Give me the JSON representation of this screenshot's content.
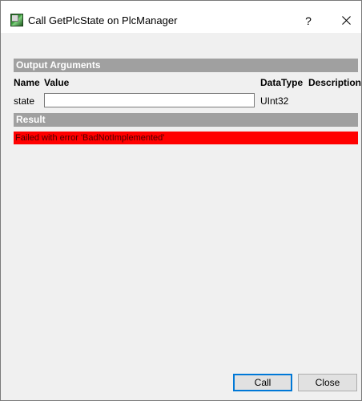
{
  "window": {
    "title": "Call GetPlcState on PlcManager",
    "help_label": "?"
  },
  "output_arguments": {
    "header": "Output Arguments",
    "columns": {
      "name": "Name",
      "value": "Value",
      "datatype": "DataType",
      "description": "Description"
    },
    "rows": [
      {
        "name": "state",
        "value": "",
        "datatype": "UInt32",
        "description": ""
      }
    ]
  },
  "result": {
    "header": "Result",
    "message": "Failed with error 'BadNotImplemented'",
    "status_color": "#ff0000"
  },
  "buttons": {
    "call_label": "Call",
    "close_label": "Close"
  },
  "colors": {
    "section_header_bg": "#a0a0a0",
    "default_button_border": "#0078d7",
    "dialog_bg": "#f0f0f0"
  }
}
